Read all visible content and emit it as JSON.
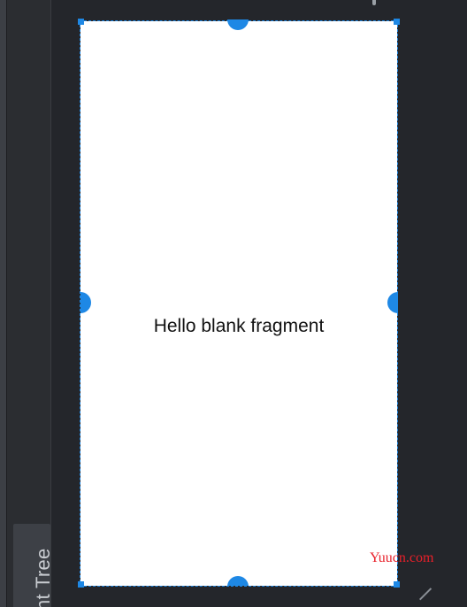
{
  "side_panel": {
    "tab_label": "nt Tree"
  },
  "preview": {
    "text": "Hello blank fragment"
  },
  "watermark": {
    "text": "Yuucn.com"
  },
  "colors": {
    "selection": "#1e88e5",
    "background": "#24262b",
    "screen": "#ffffff",
    "watermark": "#e8202a"
  }
}
